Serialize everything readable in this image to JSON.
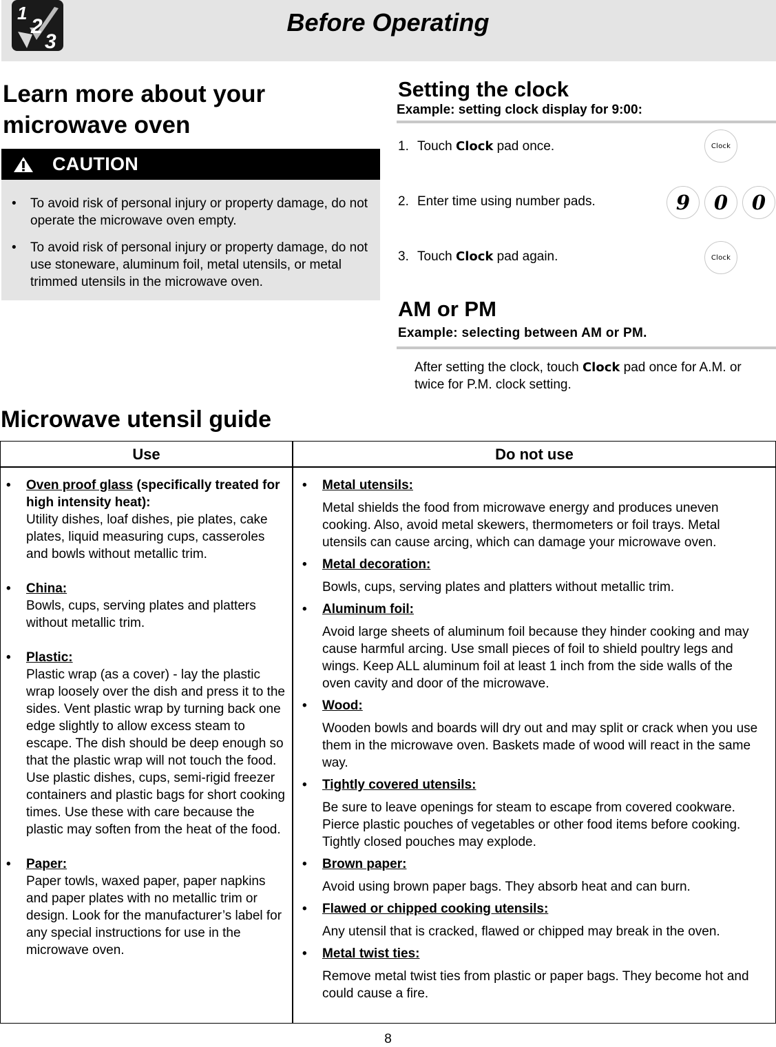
{
  "header": {
    "title": "Before Operating",
    "logo_icon": "steps-123-checkmark-icon"
  },
  "learn": {
    "title_line1": "Learn more about your",
    "title_line2": "microwave oven"
  },
  "caution": {
    "icon": "warning-triangle-icon",
    "label": "CAUTION",
    "items": [
      {
        "bullet": "•",
        "text": "To avoid risk of personal injury or property damage, do not operate the microwave oven empty."
      },
      {
        "bullet": "•",
        "text": "To avoid risk of personal injury or property damage, do not use stoneware, aluminum foil, metal utensils, or metal trimmed utensils in the microwave oven."
      }
    ]
  },
  "clock": {
    "title": "Setting the clock",
    "subtitle": "Example: setting clock display for 9:00:",
    "steps": [
      {
        "num": "1.",
        "pre": "Touch ",
        "bold": "Clock",
        "post": " pad once."
      },
      {
        "num": "2.",
        "pre": "Enter time using number pads.",
        "bold": "",
        "post": ""
      },
      {
        "num": "3.",
        "pre": "Touch ",
        "bold": "Clock",
        "post": " pad again."
      }
    ],
    "pads": {
      "clock_label": "Clock",
      "digits": [
        "9",
        "0",
        "0"
      ]
    }
  },
  "ampm": {
    "title": "AM or PM",
    "subtitle": "Example: selecting between AM or PM.",
    "body_pre": "After setting the clock, touch ",
    "body_bold": "Clock",
    "body_post": " pad once for A.M. or twice for P.M. clock setting."
  },
  "guide": {
    "title": "Microwave utensil guide",
    "col_use": "Use",
    "col_do_not_use": "Do not use",
    "use": [
      {
        "bullet": "•",
        "head_u": "Oven proof glass",
        "head_rest": " (specifically treated for high intensity heat):",
        "text": "Utility dishes, loaf dishes, pie plates, cake plates, liquid measuring cups, casseroles and bowls without metallic trim."
      },
      {
        "bullet": "•",
        "head_u": "China:",
        "head_rest": "",
        "text": "Bowls, cups, serving plates and platters without metallic trim."
      },
      {
        "bullet": "•",
        "head_u": "Plastic:",
        "head_rest": "",
        "text": "Plastic wrap (as a cover) - lay the plastic wrap loosely over the dish and press it to the sides. Vent plastic wrap by turning back one edge slightly to allow excess steam to escape. The dish should be deep enough so that the plastic wrap will not touch the food. Use plastic dishes, cups, semi-rigid freezer containers and plastic bags for short cooking times. Use these with care because the plastic may soften from the heat of the food."
      },
      {
        "bullet": "•",
        "head_u": "Paper:",
        "head_rest": "",
        "text": "Paper towls, waxed paper, paper napkins and paper plates with no metallic trim or design. Look for the manufacturer’s label for any special instructions for use in the microwave oven."
      }
    ],
    "do_not_use": [
      {
        "bullet": "•",
        "head": "Metal utensils:",
        "text": "Metal shields the food from microwave energy and produces uneven cooking. Also, avoid metal skewers, thermometers or foil trays. Metal utensils can cause arcing, which can damage your microwave oven."
      },
      {
        "bullet": "•",
        "head": "Metal decoration:",
        "text": "Bowls, cups, serving plates and platters without metallic trim."
      },
      {
        "bullet": "•",
        "head": "Aluminum foil:",
        "text": "Avoid large sheets of aluminum foil because they hinder cooking and may cause harmful arcing. Use small pieces of foil to shield poultry legs and wings. Keep ALL aluminum foil at least 1 inch from the side walls of the oven cavity and door of the microwave."
      },
      {
        "bullet": "•",
        "head": "Wood:",
        "text": "Wooden bowls and boards will dry out and may split or crack when you use them in the microwave oven. Baskets made of wood will react in the same way."
      },
      {
        "bullet": "•",
        "head": "Tightly covered utensils:",
        "text": "Be sure to leave openings for steam to escape from covered cookware. Pierce plastic pouches of vegetables or other food items before cooking. Tightly closed pouches may explode."
      },
      {
        "bullet": "•",
        "head": "Brown paper:",
        "text": "Avoid using brown paper bags. They absorb heat and can burn."
      },
      {
        "bullet": "•",
        "head": "Flawed or chipped cooking utensils:",
        "text": "Any utensil that is cracked, flawed or chipped may break in the oven."
      },
      {
        "bullet": "•",
        "head": "Metal twist ties:",
        "text": "Remove metal twist ties from plastic or paper bags. They become hot and could cause a fire."
      }
    ]
  },
  "footer": {
    "page_number": "8"
  },
  "colors": {
    "band_gray": "#e4e4e4",
    "rule_gray": "#c8c8c8",
    "caution_black": "#000000"
  }
}
